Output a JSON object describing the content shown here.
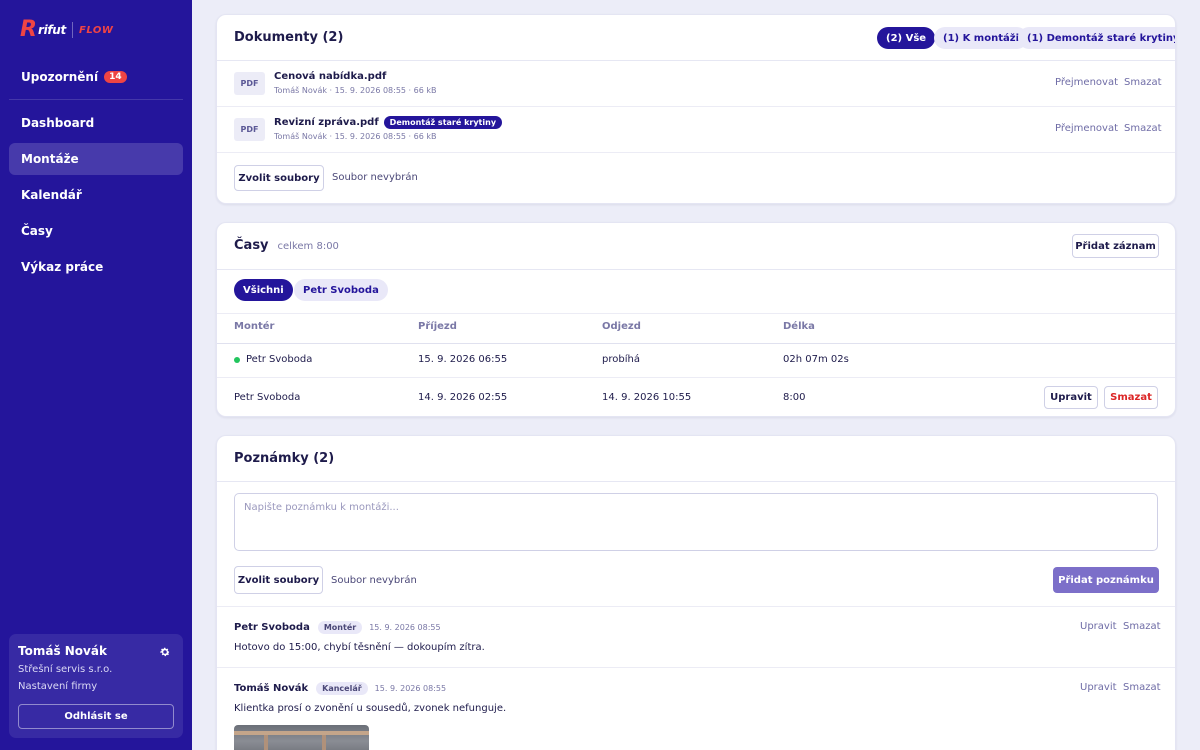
{
  "brand": {
    "mark": "R",
    "name": "rifut",
    "product": "FLOW"
  },
  "sidebar": {
    "notifications": {
      "label": "Upozornění",
      "count": "14"
    },
    "nav": [
      {
        "label": "Dashboard"
      },
      {
        "label": "Montáže"
      },
      {
        "label": "Kalendář"
      },
      {
        "label": "Časy"
      },
      {
        "label": "Výkaz práce"
      }
    ],
    "active_index": 1,
    "user": {
      "name": "Tomáš Novák",
      "company": "Střešní servis s.r.o.",
      "settings_link": "Nastavení firmy",
      "logout": "Odhlásit se"
    }
  },
  "documents": {
    "title": "Dokumenty (2)",
    "filters": [
      "(2) Vše",
      "(1) K montáži",
      "(1) Demontáž staré krytiny"
    ],
    "files": [
      {
        "icon": "PDF",
        "name": "Cenová nabídka.pdf",
        "tag": "",
        "meta": "Tomáš Novák · 15. 9. 2026 08:55 · 66 kB",
        "rename": "Přejmenovat",
        "delete": "Smazat"
      },
      {
        "icon": "PDF",
        "name": "Revizní zpráva.pdf",
        "tag": "Demontáž staré krytiny",
        "meta": "Tomáš Novák · 15. 9. 2026 08:55 · 66 kB",
        "rename": "Přejmenovat",
        "delete": "Smazat"
      }
    ],
    "choose_files": "Zvolit soubory",
    "no_file": "Soubor nevybrán"
  },
  "times": {
    "title": "Časy",
    "total": "celkem 8:00",
    "add": "Přidat záznam",
    "filters": [
      "Všichni",
      "Petr Svoboda"
    ],
    "columns": [
      "Montér",
      "Příjezd",
      "Odjezd",
      "Délka"
    ],
    "rows": [
      {
        "worker": "Petr Svoboda",
        "arrival": "15. 9. 2026 06:55",
        "departure": "probíhá",
        "duration": "02h 07m 02s",
        "active": true
      },
      {
        "worker": "Petr Svoboda",
        "arrival": "14. 9. 2026 02:55",
        "departure": "14. 9. 2026 10:55",
        "duration": "8:00",
        "edit": "Upravit",
        "delete": "Smazat"
      }
    ]
  },
  "notes": {
    "title": "Poznámky (2)",
    "placeholder": "Napište poznámku k montáži...",
    "choose_files": "Zvolit soubory",
    "no_file": "Soubor nevybrán",
    "add": "Přidat poznámku",
    "items": [
      {
        "author": "Petr Svoboda",
        "role": "Montér",
        "time": "15. 9. 2026 08:55",
        "text": "Hotovo do 15:00, chybí těsnění — dokoupím zítra.",
        "edit": "Upravit",
        "delete": "Smazat"
      },
      {
        "author": "Tomáš Novák",
        "role": "Kancelář",
        "time": "15. 9. 2026 08:55",
        "text": "Klientka prosí o zvonění u sousedů, zvonek nefunguje.",
        "edit": "Upravit",
        "delete": "Smazat"
      }
    ]
  },
  "colors": {
    "sidebar": "#24159b",
    "accent": "#24159b",
    "danger": "#ef4444",
    "success": "#22c55e",
    "background": "#ecedf8"
  }
}
